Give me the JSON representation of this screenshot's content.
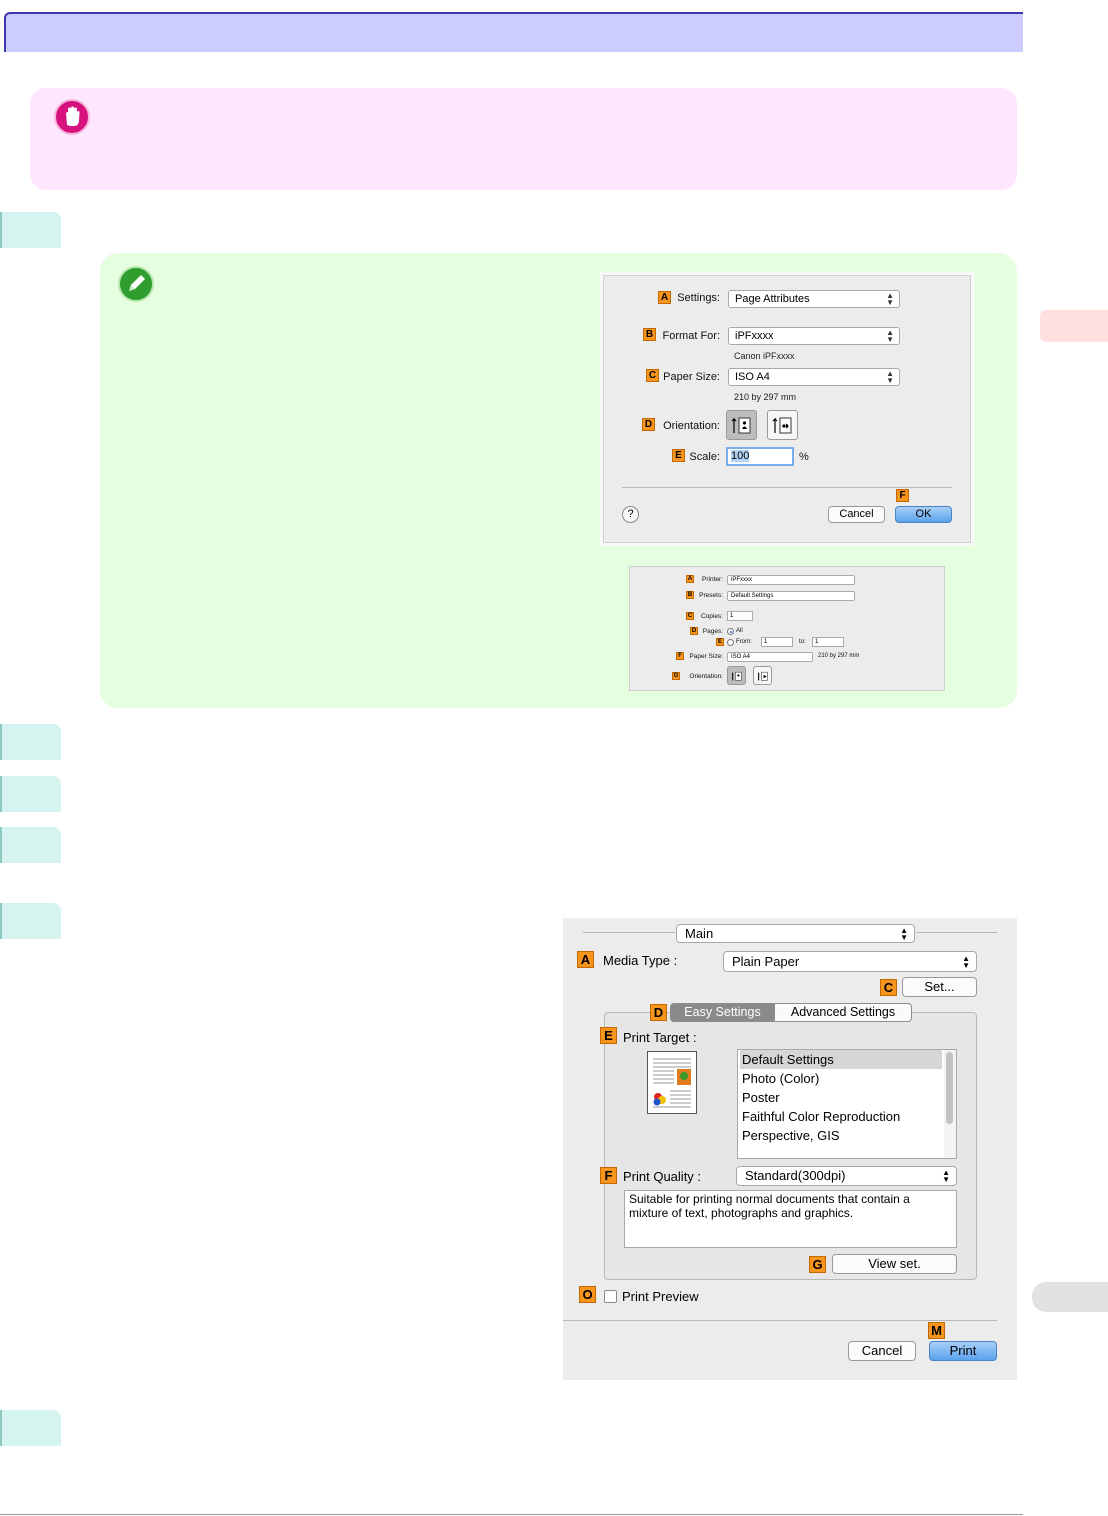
{
  "dialog_page_setup": {
    "settings_label": "Settings:",
    "settings_value": "Page Attributes",
    "format_for_label": "Format For:",
    "format_for_value": "iPFxxxx",
    "format_for_sub": "Canon iPFxxxx",
    "paper_size_label": "Paper Size:",
    "paper_size_value": "ISO A4",
    "paper_size_sub": "210 by 297 mm",
    "orientation_label": "Orientation:",
    "scale_label": "Scale:",
    "scale_value": "100",
    "scale_unit": "%",
    "help_label": "?",
    "cancel_label": "Cancel",
    "ok_label": "OK"
  },
  "dialog_print_small": {
    "printer_label": "Printer:",
    "printer_value": "iPFxxxx",
    "presets_label": "Presets:",
    "presets_value": "Default Settings",
    "copies_label": "Copies:",
    "copies_value": "1",
    "pages_label": "Pages:",
    "pages_all": "All",
    "pages_from": "From:",
    "pages_from_value": "1",
    "pages_to": "to:",
    "pages_to_value": "1",
    "paper_size_label": "Paper Size:",
    "paper_size_value": "ISO A4",
    "paper_size_sub": "210 by 297 mm",
    "orientation_label": "Orientation:"
  },
  "dialog_print_main": {
    "panel_value": "Main",
    "media_type_label": "Media Type :",
    "media_type_value": "Plain Paper",
    "set_label": "Set...",
    "tab_easy": "Easy Settings",
    "tab_advanced": "Advanced Settings",
    "print_target_label": "Print Target :",
    "print_targets": [
      "Default Settings",
      "Photo (Color)",
      "Poster",
      "Faithful Color Reproduction",
      "Perspective, GIS"
    ],
    "print_quality_label": "Print Quality :",
    "print_quality_value": "Standard(300dpi)",
    "quality_description": "Suitable for printing normal documents that contain a mixture of text, photographs and graphics.",
    "view_set_label": "View set.",
    "print_preview_label": "Print Preview",
    "cancel_label": "Cancel",
    "print_label": "Print"
  },
  "badges": {
    "a": "A",
    "b": "B",
    "c": "C",
    "d": "D",
    "e": "E",
    "f": "F",
    "g": "G",
    "m": "M",
    "o": "O"
  },
  "colors": {
    "title_bar": "#ccccff",
    "important_bg": "#ffe6ff",
    "note_bg": "#e6fee0",
    "step_tab": "#d5f3ef",
    "badge": "#f7941d"
  }
}
